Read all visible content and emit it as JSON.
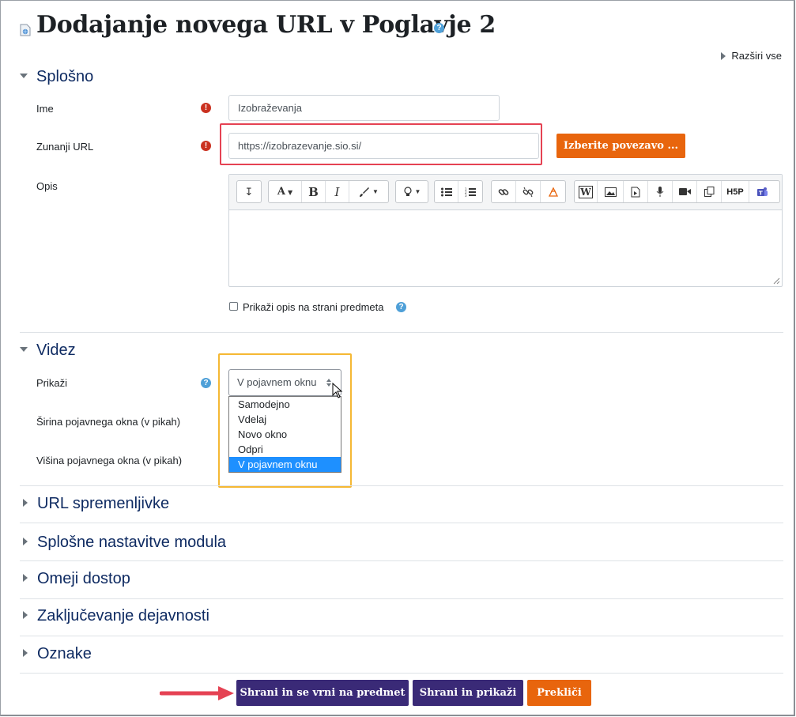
{
  "header": {
    "title": "Dodajanje novega URL v Poglavje 2",
    "expand_all": "Razširi vse"
  },
  "sections": {
    "general": {
      "title": "Splošno",
      "name_label": "Ime",
      "name_value": "Izobraževanja",
      "url_label": "Zunanji URL",
      "url_value": "https://izobrazevanje.sio.si/",
      "choose_link_label": "Izberite povezavo ...",
      "description_label": "Opis",
      "show_description_label": "Prikaži opis na strani predmeta"
    },
    "appearance": {
      "title": "Videz",
      "display_label": "Prikaži",
      "display_value": "V pojavnem oknu",
      "popup_width_label": "Širina pojavnega okna (v pikah)",
      "popup_height_label": "Višina pojavnega okna (v pikah)",
      "display_options": [
        "Samodejno",
        "Vdelaj",
        "Novo okno",
        "Odpri",
        "V pojavnem oknu"
      ],
      "selected_option": "V pojavnem oknu"
    },
    "collapsed": [
      "URL spremenljivke",
      "Splošne nastavitve modula",
      "Omeji dostop",
      "Zaključevanje dejavnosti",
      "Oznake"
    ]
  },
  "editor_toolbar": {
    "icons": [
      "collapse-icon",
      "font-icon",
      "bold-icon",
      "italic-icon",
      "paint-brush-icon",
      "lightbulb-icon",
      "unordered-list-icon",
      "ordered-list-icon",
      "link-icon",
      "unlink-icon",
      "emoji-icon",
      "word-import-icon",
      "image-icon",
      "media-icon",
      "microphone-icon",
      "video-icon",
      "copy-icon",
      "h5p-icon",
      "teams-icon"
    ],
    "bold": "B",
    "italic": "I",
    "font": "A",
    "h5p": "H5P",
    "word": "W"
  },
  "actions": {
    "save_return": "Shrani in se vrni na predmet",
    "save_display": "Shrani in prikaži",
    "cancel": "Prekliči"
  },
  "colors": {
    "primary": "#3a2a77",
    "orange": "#e8650d",
    "required": "#ca3120",
    "help": "#4fa0d8",
    "highlight_red": "#e54253",
    "highlight_yellow": "#f5b834",
    "selected_option": "#1e90ff"
  }
}
